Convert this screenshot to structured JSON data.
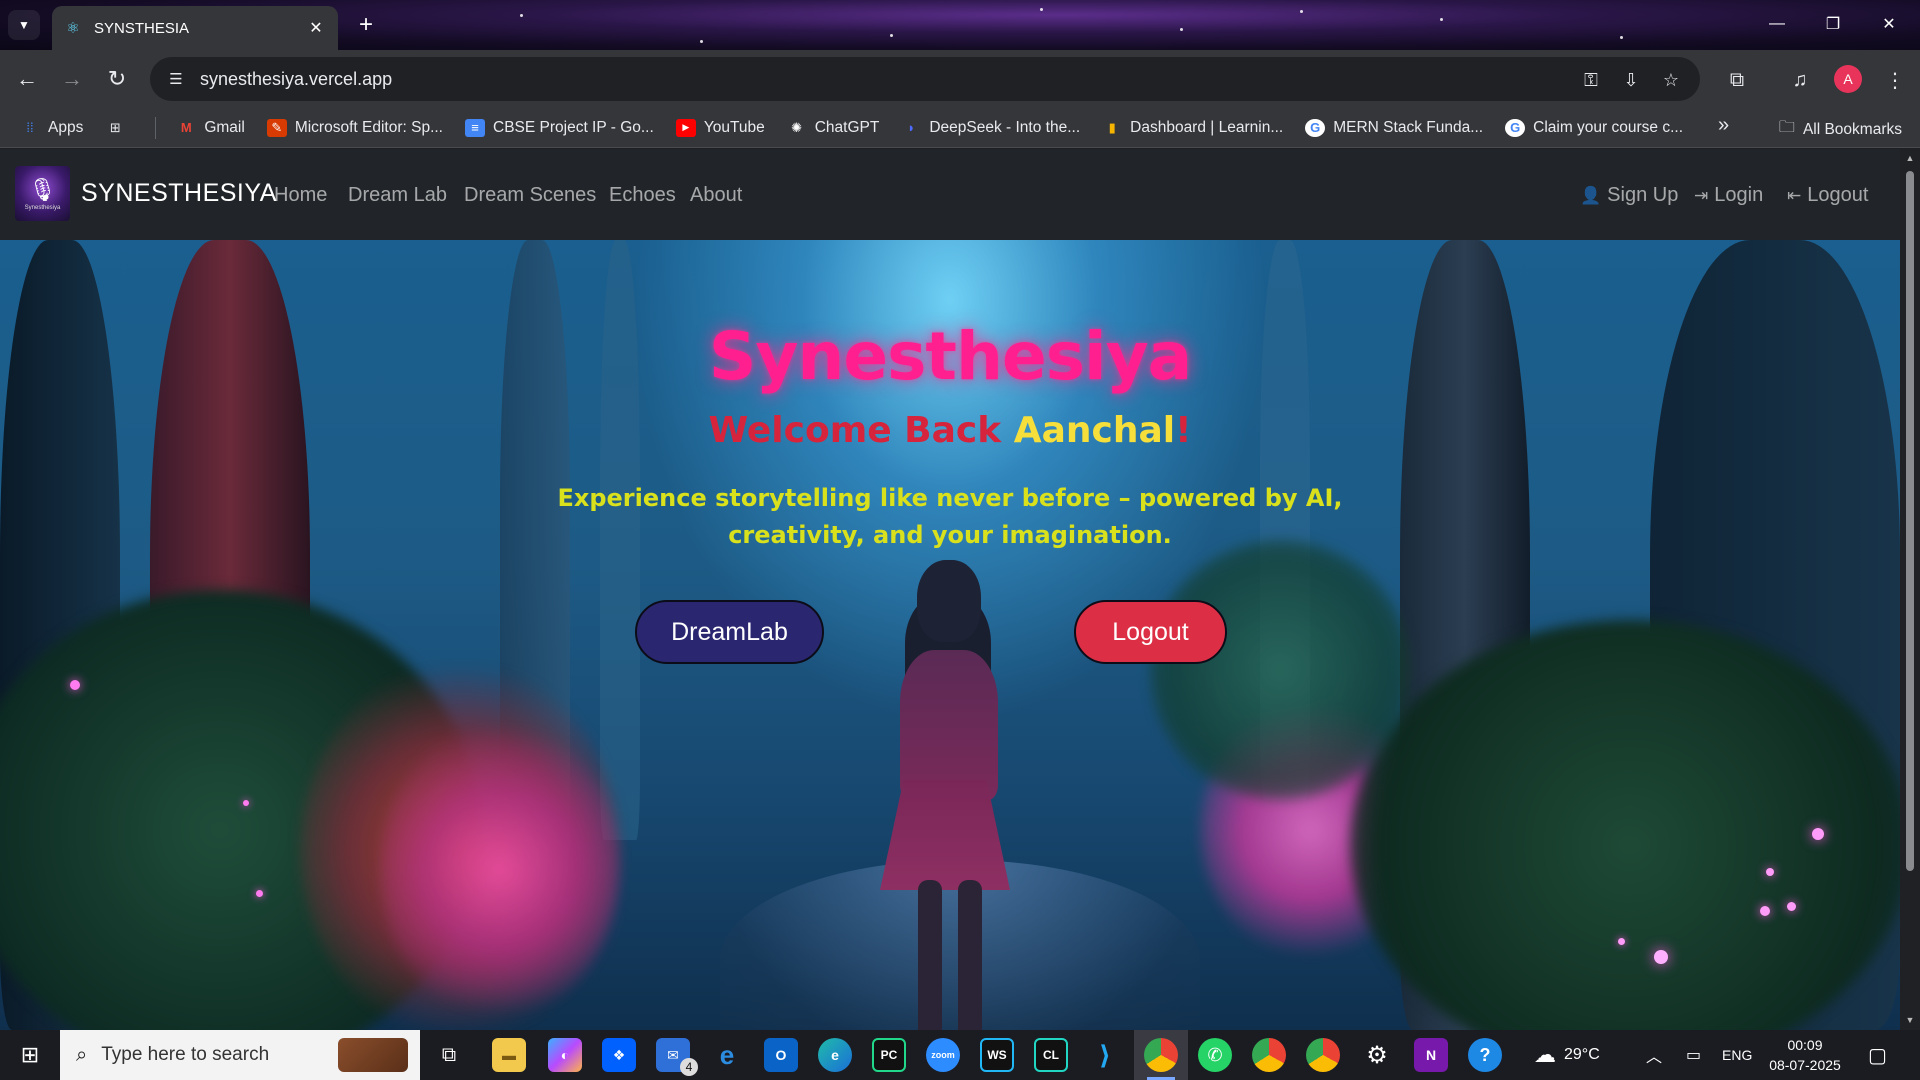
{
  "browser": {
    "tab": {
      "title": "SYNSTHESIA",
      "favicon": "react-icon"
    },
    "url": "synesthesiya.vercel.app",
    "profile_initial": "A",
    "bookmarks": [
      {
        "label": "Apps",
        "icon": "apps-grid-icon",
        "color": "#4285f4"
      },
      {
        "label": "",
        "icon": "grid-icon",
        "color": "#e8eaed"
      },
      {
        "label": "Gmail",
        "icon": "gmail-icon",
        "color": "#ea4335"
      },
      {
        "label": "Microsoft Editor: Sp...",
        "icon": "editor-icon",
        "color": "#d83b01"
      },
      {
        "label": "CBSE Project IP - Go...",
        "icon": "docs-icon",
        "color": "#4285f4"
      },
      {
        "label": "YouTube",
        "icon": "youtube-icon",
        "color": "#ff0000"
      },
      {
        "label": "ChatGPT",
        "icon": "chatgpt-icon",
        "color": "#ffffff"
      },
      {
        "label": "DeepSeek - Into the...",
        "icon": "deepseek-icon",
        "color": "#4d6bfe"
      },
      {
        "label": "Dashboard | Learnin...",
        "icon": "dashboard-icon",
        "color": "#f4b400"
      },
      {
        "label": "MERN Stack Funda...",
        "icon": "google-icon",
        "color": "#ffffff"
      },
      {
        "label": "Claim your course c...",
        "icon": "google-icon",
        "color": "#ffffff"
      }
    ],
    "all_bookmarks": "All Bookmarks"
  },
  "site": {
    "brand": "SYNESTHESIYA",
    "logo_text": "Synesthesiya",
    "nav": [
      "Home",
      "Dream Lab",
      "Dream Scenes",
      "Echoes",
      "About"
    ],
    "auth": {
      "signup": "Sign Up",
      "login": "Login",
      "logout": "Logout"
    }
  },
  "hero": {
    "title": "Synesthesiya",
    "welcome_prefix": "Welcome Back ",
    "welcome_name": "Aanchal",
    "welcome_suffix": "!",
    "tagline": "Experience storytelling like never before – powered by AI, creativity, and your imagination.",
    "primary_button": "DreamLab",
    "secondary_button": "Logout",
    "colors": {
      "title": "#ff1f8e",
      "welcome": "#d6243c",
      "name": "#f6df3a",
      "tagline": "#d9e01c",
      "dreamlab_btn": "#2a2770",
      "logout_btn": "#dc2f45"
    }
  },
  "taskbar": {
    "search_placeholder": "Type here to search",
    "mail_badge": "4",
    "weather": "29°C",
    "language": "ENG",
    "time": "00:09",
    "date": "08-07-2025",
    "pinned_apps": [
      "file-explorer",
      "copilot",
      "dropbox",
      "mail",
      "internet-explorer",
      "outlook",
      "edge",
      "pycharm",
      "zoom",
      "webstorm",
      "clion",
      "vscode",
      "chrome",
      "whatsapp",
      "chrome-profile-d",
      "chrome-profile-a",
      "settings",
      "onenote",
      "help"
    ]
  }
}
